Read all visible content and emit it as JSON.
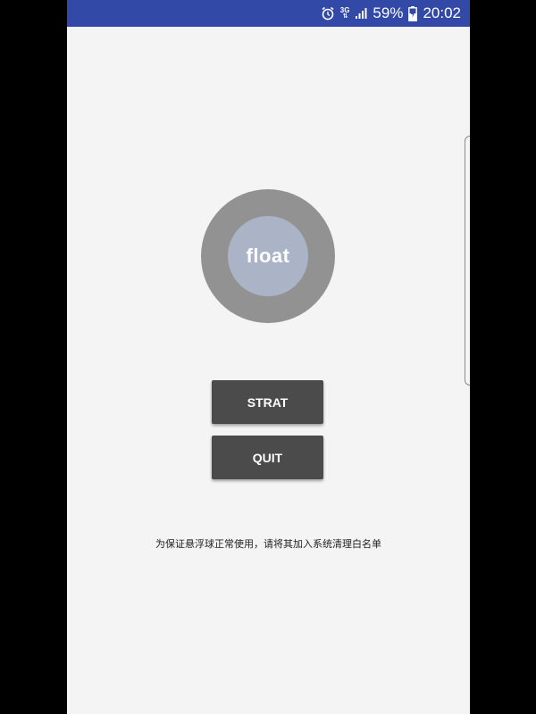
{
  "status_bar": {
    "network": "3G",
    "battery_percent": "59%",
    "time": "20:02",
    "icons": [
      "alarm-icon",
      "signal-icon",
      "battery-icon"
    ],
    "background_color": "#3349a8"
  },
  "float_ball": {
    "label": "float",
    "outer_color": "#929292",
    "inner_color": "#abb3c6"
  },
  "buttons": {
    "start_label": "STRAT",
    "quit_label": "QUIT",
    "color": "#4b4b4b"
  },
  "notice": {
    "text": "为保证悬浮球正常使用，请将其加入系统清理白名单"
  }
}
